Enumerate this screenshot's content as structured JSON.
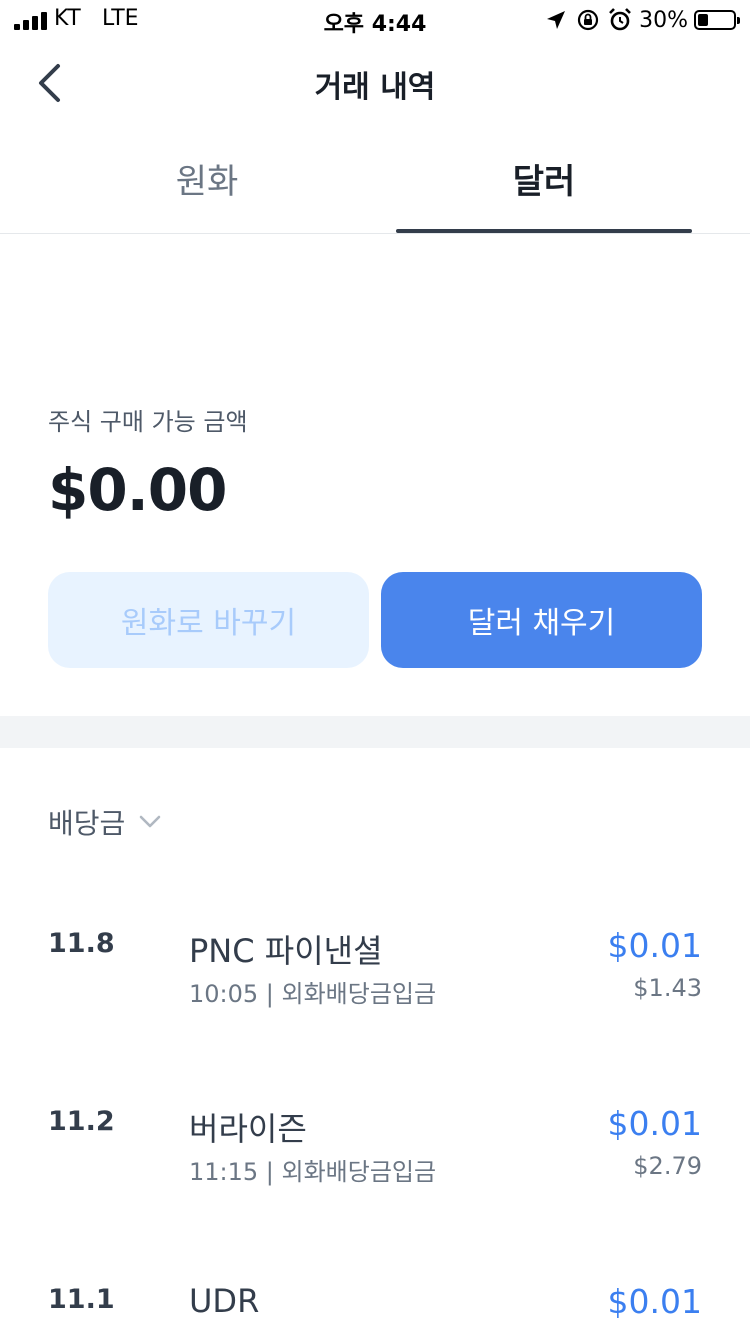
{
  "status_bar": {
    "carrier": "KT",
    "network": "LTE",
    "time": "오후 4:44",
    "battery_percent": "30%",
    "battery_level": 0.3
  },
  "nav": {
    "title": "거래 내역",
    "back_icon": "chevron-left-icon"
  },
  "tabs": [
    {
      "label": "원화",
      "active": false
    },
    {
      "label": "달러",
      "active": true
    }
  ],
  "balance": {
    "label": "주식 구매 가능 금액",
    "amount": "$0.00"
  },
  "buttons": {
    "convert_label": "원화로 바꾸기",
    "fill_label": "달러 채우기"
  },
  "filter": {
    "label": "배당금",
    "icon": "chevron-down-icon"
  },
  "transactions": [
    {
      "date": "11.8",
      "name": "PNC 파이낸셜",
      "detail": "10:05 | 외화배당금입금",
      "amount": "$0.01",
      "balance": "$1.43"
    },
    {
      "date": "11.2",
      "name": "버라이즌",
      "detail": "11:15 | 외화배당금입금",
      "amount": "$0.01",
      "balance": "$2.79"
    },
    {
      "date": "11.1",
      "name": "UDR",
      "detail": "",
      "amount": "$0.01",
      "balance": ""
    }
  ],
  "colors": {
    "accent": "#4a85ec",
    "accent_light": "#e8f3ff",
    "amount_blue": "#3b7ff0",
    "text_primary": "#191f28",
    "text_secondary": "#6b7684"
  }
}
